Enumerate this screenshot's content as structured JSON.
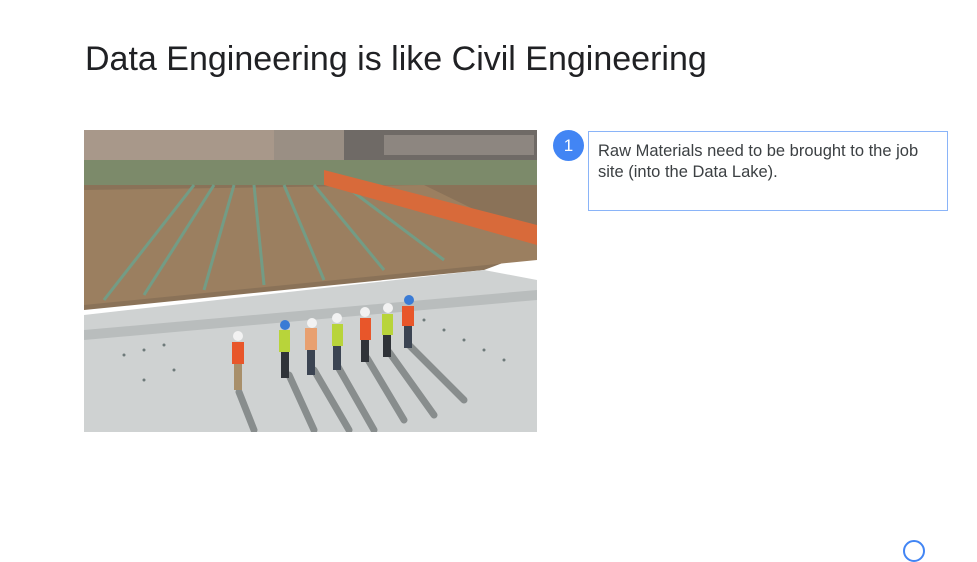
{
  "slide": {
    "title": "Data Engineering is like Civil Engineering"
  },
  "photo": {
    "alt": "construction workers in hard hats standing on a concrete slab at a construction site"
  },
  "step": {
    "number": "1",
    "text": "Raw Materials need to be brought to the job site (into the Data Lake)."
  },
  "colors": {
    "accent": "#4285f4",
    "box_border": "#8ab4f8",
    "title": "#202124"
  }
}
